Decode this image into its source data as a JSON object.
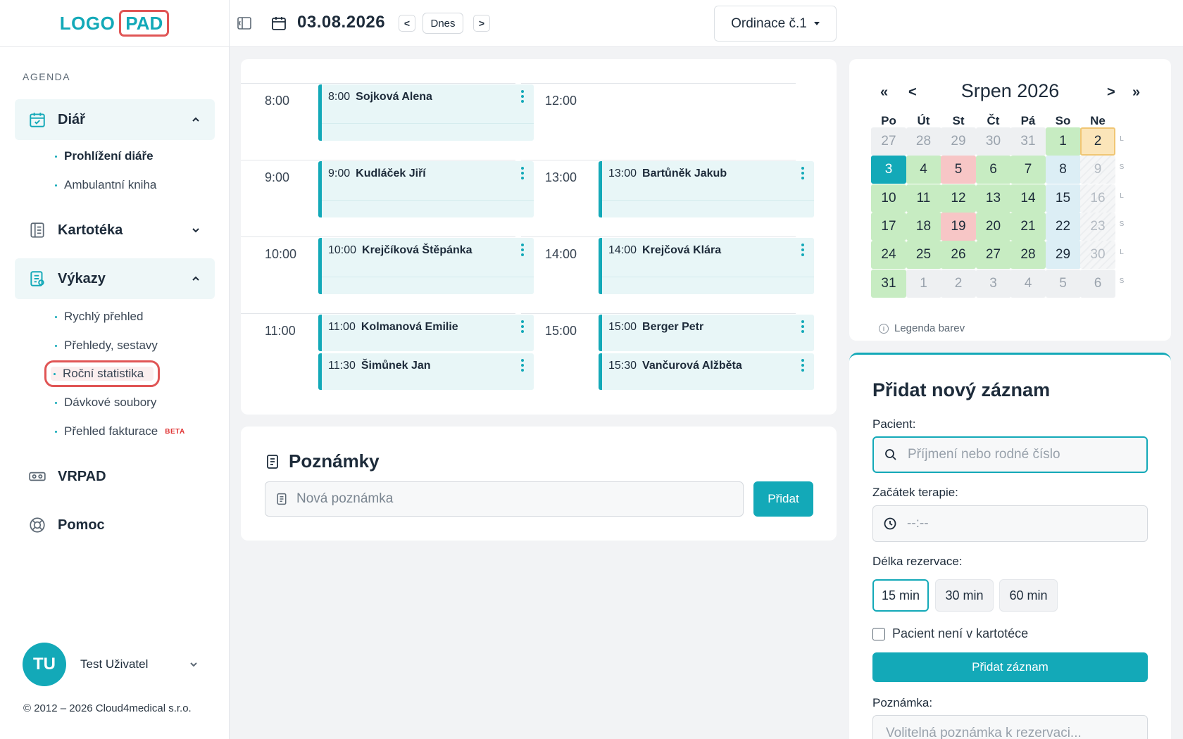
{
  "logo": {
    "left": "LOGO",
    "right": "PAD"
  },
  "sidebar": {
    "section": "AGENDA",
    "diar": {
      "label": "Diář",
      "items": [
        "Prohlížení diáře",
        "Ambulantní kniha"
      ]
    },
    "kartoteka": {
      "label": "Kartotéka"
    },
    "vykazy": {
      "label": "Výkazy",
      "items": [
        "Rychlý přehled",
        "Přehledy, sestavy",
        "Roční statistika",
        "Dávkové soubory",
        "Přehled fakturace"
      ],
      "beta": "BETA"
    },
    "vrpad": {
      "label": "VRPAD"
    },
    "pomoc": {
      "label": "Pomoc"
    },
    "user": {
      "initials": "TU",
      "name": "Test Uživatel"
    },
    "copyright": "© 2012 – 2026 Cloud4medical s.r.o."
  },
  "topbar": {
    "date": "03.08.2026",
    "today": "Dnes",
    "prev": "<",
    "next": ">",
    "ordinace": "Ordinace č.1"
  },
  "schedule": {
    "left": [
      {
        "hour": "8:00",
        "appts": [
          {
            "time": "8:00",
            "name": "Sojková Alena"
          }
        ]
      },
      {
        "hour": "9:00",
        "appts": [
          {
            "time": "9:00",
            "name": "Kudláček Jiří"
          }
        ]
      },
      {
        "hour": "10:00",
        "appts": [
          {
            "time": "10:00",
            "name": "Krejčíková Štěpánka"
          }
        ]
      },
      {
        "hour": "11:00",
        "appts": [
          {
            "time": "11:00",
            "name": "Kolmanová Emilie"
          },
          {
            "time": "11:30",
            "name": "Šimůnek Jan"
          }
        ]
      }
    ],
    "right": [
      {
        "hour": "12:00",
        "appts": []
      },
      {
        "hour": "13:00",
        "appts": [
          {
            "time": "13:00",
            "name": "Bartůněk Jakub"
          }
        ]
      },
      {
        "hour": "14:00",
        "appts": [
          {
            "time": "14:00",
            "name": "Krejčová Klára"
          }
        ]
      },
      {
        "hour": "15:00",
        "appts": [
          {
            "time": "15:00",
            "name": "Berger Petr"
          },
          {
            "time": "15:30",
            "name": "Vančurová Alžběta"
          }
        ]
      }
    ]
  },
  "notes": {
    "title": "Poznámky",
    "placeholder": "Nová poznámka",
    "add": "Přidat"
  },
  "calendar": {
    "title": "Srpen 2026",
    "nav": {
      "first": "«",
      "prev": "<",
      "next": ">",
      "last": "»"
    },
    "weekdays": [
      "Po",
      "Út",
      "St",
      "Čt",
      "Pá",
      "So",
      "Ne"
    ],
    "weekend_marks": [
      "L",
      "S",
      "L",
      "S",
      "L",
      "S"
    ],
    "weeks": [
      [
        {
          "d": "27",
          "s": "out"
        },
        {
          "d": "28",
          "s": "out"
        },
        {
          "d": "29",
          "s": "out"
        },
        {
          "d": "30",
          "s": "out"
        },
        {
          "d": "31",
          "s": "out"
        },
        {
          "d": "1",
          "s": "green"
        },
        {
          "d": "2",
          "s": "sel"
        }
      ],
      [
        {
          "d": "3",
          "s": "today"
        },
        {
          "d": "4",
          "s": "green"
        },
        {
          "d": "5",
          "s": "red"
        },
        {
          "d": "6",
          "s": "green"
        },
        {
          "d": "7",
          "s": "green"
        },
        {
          "d": "8",
          "s": "blue"
        },
        {
          "d": "9",
          "s": "sun"
        }
      ],
      [
        {
          "d": "10",
          "s": "green"
        },
        {
          "d": "11",
          "s": "green"
        },
        {
          "d": "12",
          "s": "green"
        },
        {
          "d": "13",
          "s": "green"
        },
        {
          "d": "14",
          "s": "green"
        },
        {
          "d": "15",
          "s": "blue"
        },
        {
          "d": "16",
          "s": "sun"
        }
      ],
      [
        {
          "d": "17",
          "s": "green"
        },
        {
          "d": "18",
          "s": "green"
        },
        {
          "d": "19",
          "s": "red"
        },
        {
          "d": "20",
          "s": "green"
        },
        {
          "d": "21",
          "s": "green"
        },
        {
          "d": "22",
          "s": "blue"
        },
        {
          "d": "23",
          "s": "sun"
        }
      ],
      [
        {
          "d": "24",
          "s": "green"
        },
        {
          "d": "25",
          "s": "green"
        },
        {
          "d": "26",
          "s": "green"
        },
        {
          "d": "27",
          "s": "green"
        },
        {
          "d": "28",
          "s": "green"
        },
        {
          "d": "29",
          "s": "blue"
        },
        {
          "d": "30",
          "s": "sun"
        }
      ],
      [
        {
          "d": "31",
          "s": "green"
        },
        {
          "d": "1",
          "s": "out"
        },
        {
          "d": "2",
          "s": "out"
        },
        {
          "d": "3",
          "s": "out"
        },
        {
          "d": "4",
          "s": "out"
        },
        {
          "d": "5",
          "s": "out"
        },
        {
          "d": "6",
          "s": "out"
        }
      ]
    ],
    "legend": "Legenda barev"
  },
  "newrec": {
    "title": "Přidat nový záznam",
    "patient_label": "Pacient:",
    "patient_placeholder": "Příjmení nebo rodné číslo",
    "start_label": "Začátek terapie:",
    "start_placeholder": "--:--",
    "duration_label": "Délka rezervace:",
    "durations": [
      "15 min",
      "30 min",
      "60 min"
    ],
    "not_in_registry": "Pacient není v kartotéce",
    "submit": "Přidat záznam",
    "note_label": "Poznámka:",
    "note_placeholder": "Volitelná poznámka k rezervaci..."
  },
  "colors": {
    "accent": "#13a9b8",
    "highlight": "#e05555"
  }
}
